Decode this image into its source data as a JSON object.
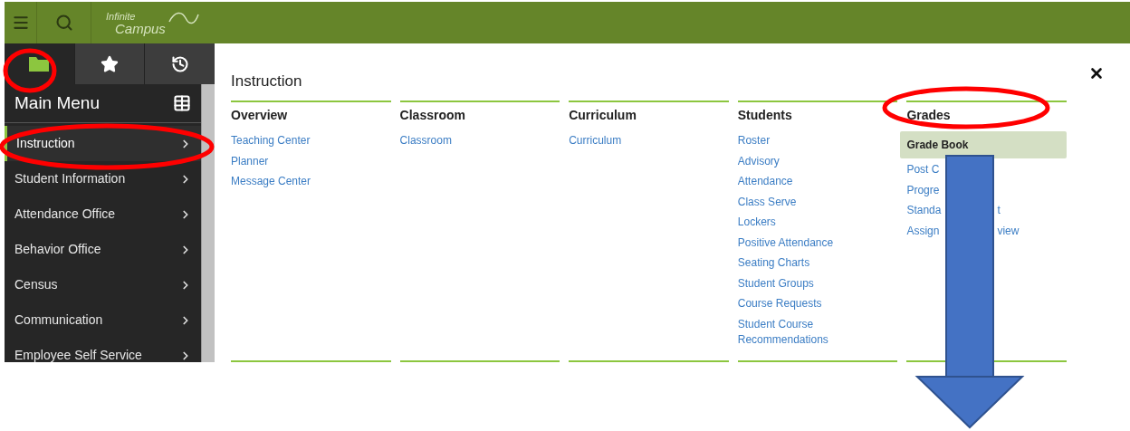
{
  "header": {
    "logo": {
      "line1": "Infinite",
      "line2": "Campus"
    }
  },
  "sidebar": {
    "tabs": [
      {
        "kind": "folder",
        "selected": true
      },
      {
        "kind": "star",
        "selected": false
      },
      {
        "kind": "history",
        "selected": false
      }
    ],
    "title": "Main Menu",
    "items": [
      {
        "label": "Instruction",
        "selected": true
      },
      {
        "label": "Student Information",
        "selected": false
      },
      {
        "label": "Attendance Office",
        "selected": false
      },
      {
        "label": "Behavior Office",
        "selected": false
      },
      {
        "label": "Census",
        "selected": false
      },
      {
        "label": "Communication",
        "selected": false
      },
      {
        "label": "Employee Self Service",
        "selected": false
      }
    ]
  },
  "panel": {
    "title": "Instruction",
    "columns": [
      {
        "heading": "Overview",
        "links": [
          {
            "text": "Teaching Center",
            "selected": false
          },
          {
            "text": "Planner",
            "selected": false
          },
          {
            "text": "Message Center",
            "selected": false
          }
        ]
      },
      {
        "heading": "Classroom",
        "links": [
          {
            "text": "Classroom",
            "selected": false
          }
        ]
      },
      {
        "heading": "Curriculum",
        "links": [
          {
            "text": "Curriculum",
            "selected": false
          }
        ]
      },
      {
        "heading": "Students",
        "links": [
          {
            "text": "Roster",
            "selected": false
          },
          {
            "text": "Advisory",
            "selected": false
          },
          {
            "text": "Attendance",
            "selected": false
          },
          {
            "text": "Class Serve",
            "selected": false
          },
          {
            "text": "Lockers",
            "selected": false
          },
          {
            "text": "Positive Attendance",
            "selected": false
          },
          {
            "text": "Seating Charts",
            "selected": false
          },
          {
            "text": "Student Groups",
            "selected": false
          },
          {
            "text": "Course Requests",
            "selected": false
          },
          {
            "text": "Student Course Recommendations",
            "selected": false
          }
        ]
      },
      {
        "heading": "Grades",
        "links": [
          {
            "text": "Grade Book",
            "selected": true
          },
          {
            "text": "Post C",
            "selected": false
          },
          {
            "text": "Progre",
            "selected": false
          },
          {
            "text": "Standa",
            "tail": "t",
            "selected": false
          },
          {
            "text": "Assign",
            "tail": "view",
            "selected": false
          }
        ]
      }
    ]
  },
  "annotations": [
    {
      "kind": "ellipse"
    },
    {
      "kind": "ellipse"
    },
    {
      "kind": "ellipse"
    },
    {
      "kind": "arrow"
    }
  ]
}
